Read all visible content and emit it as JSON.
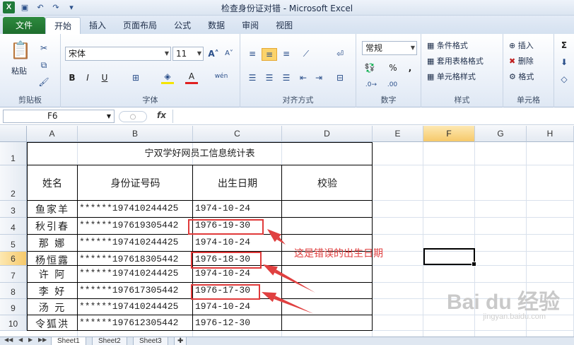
{
  "window": {
    "title": "检查身份证对错 - Microsoft Excel",
    "app_badge": "X"
  },
  "ribbon_tabs": [
    "文件",
    "开始",
    "插入",
    "页面布局",
    "公式",
    "数据",
    "审阅",
    "视图"
  ],
  "ribbon": {
    "clipboard": {
      "paste": "粘贴",
      "label": "剪贴板"
    },
    "font": {
      "name": "宋体",
      "size": "11",
      "label": "字体",
      "bold": "B",
      "italic": "I",
      "underline": "U",
      "color_glyph": "A",
      "wen": "wén"
    },
    "alignment": {
      "label": "对齐方式"
    },
    "number": {
      "format": "常规",
      "label": "数字",
      "percent": "%",
      "comma": ","
    },
    "styles": {
      "conditional": "条件格式",
      "table_format": "套用表格格式",
      "cell_style": "单元格样式",
      "label": "样式"
    },
    "cells": {
      "insert": "插入",
      "delete": "删除",
      "format": "格式",
      "label": "单元格"
    },
    "editing": {
      "sigma": "Σ"
    }
  },
  "formula_bar": {
    "name_box": "F6",
    "fx": "fx"
  },
  "sheet": {
    "columns": [
      "A",
      "B",
      "C",
      "D",
      "E",
      "F",
      "G",
      "H"
    ],
    "selected_column": "F",
    "selected_row": "6",
    "rows": [
      "1",
      "2",
      "3",
      "4",
      "5",
      "6",
      "7",
      "8",
      "9",
      "10"
    ],
    "table_title": "宁双学好网员工信息统计表",
    "headers": [
      "姓名",
      "身份证号码",
      "出生日期",
      "校验"
    ],
    "records": [
      {
        "name": "鱼家羊",
        "id": "******197410244425",
        "birth": "1974-10-24"
      },
      {
        "name": "秋引春",
        "id": "******197619305442",
        "birth": "1976-19-30"
      },
      {
        "name": "那 娜",
        "id": "******197410244425",
        "birth": "1974-10-24"
      },
      {
        "name": "杨恒露",
        "id": "******197618305442",
        "birth": "1976-18-30"
      },
      {
        "name": "许 阿",
        "id": "******197410244425",
        "birth": "1974-10-24"
      },
      {
        "name": "李 好",
        "id": "******197617305442",
        "birth": "1976-17-30"
      },
      {
        "name": "汤 元",
        "id": "******197410244425",
        "birth": "1974-10-24"
      },
      {
        "name": "令狐洪",
        "id": "******197612305442",
        "birth": "1976-12-30"
      }
    ],
    "annotation": "这是错误的出生日期",
    "annotation_color": "#e04040"
  },
  "sheet_tabs": [
    "Sheet1",
    "Sheet2",
    "Sheet3"
  ],
  "watermark": {
    "brand": "Bai du 经验",
    "url": "jingyan.baidu.com"
  }
}
